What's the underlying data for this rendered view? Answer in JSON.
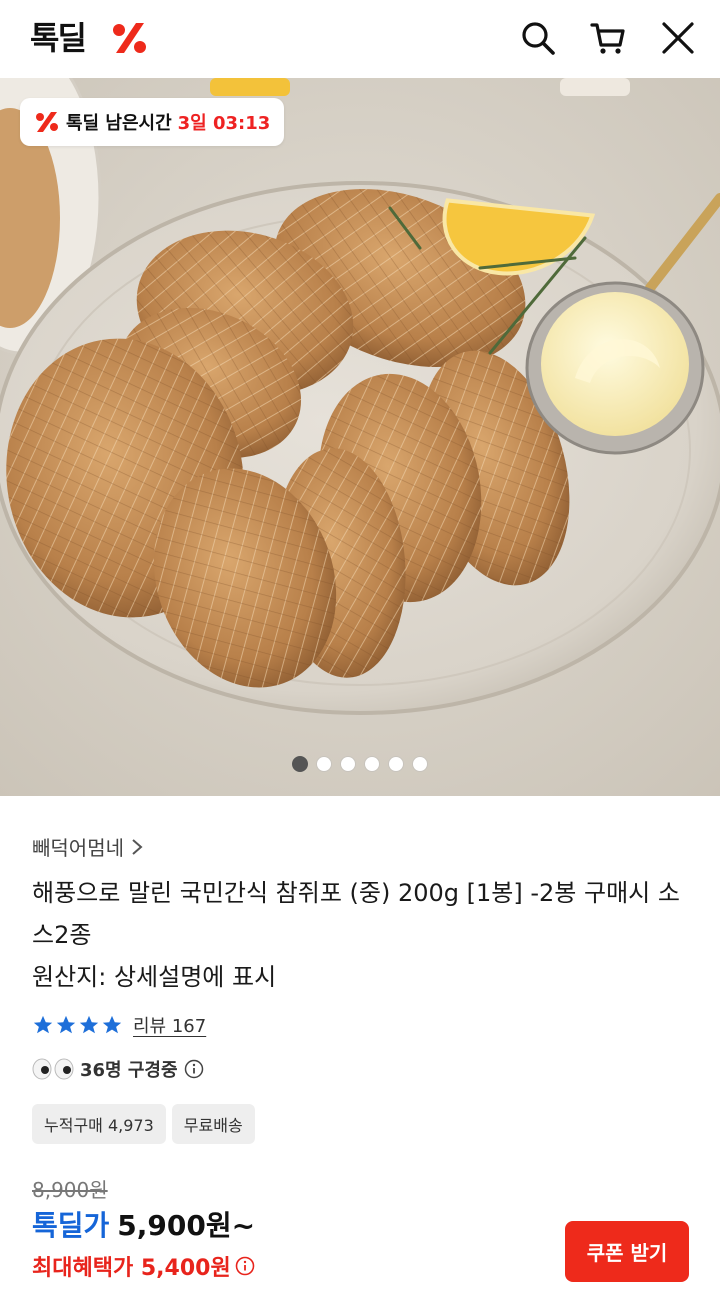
{
  "header": {
    "logo_text": "톡딜",
    "icons": [
      "search-icon",
      "cart-icon",
      "close-icon"
    ]
  },
  "hero": {
    "timer_label": "톡딜 남은시간",
    "timer_value": "3일 03:13",
    "image_count": 6,
    "active_index": 0
  },
  "product": {
    "seller": "빼덕어멈네",
    "title": "해풍으로 말린 국민간식 참쥐포 (중) 200g [1봉] -2봉 구매시 소스2종",
    "origin": "원산지: 상세설명에 표시",
    "rating_stars": 4,
    "review_text": "리뷰 167",
    "viewers_text": "36명 구경중",
    "badges": [
      "누적구매 4,973",
      "무료배송"
    ],
    "original_price": "8,900원",
    "deal_label": "톡딜가",
    "deal_price": "5,900원~",
    "max_benefit": "최대혜택가 5,400원",
    "coupon_button": "쿠폰 받기"
  },
  "colors": {
    "brand_red": "#ee2a1b",
    "deal_blue": "#1565d8",
    "star_blue": "#1e6fd9"
  }
}
